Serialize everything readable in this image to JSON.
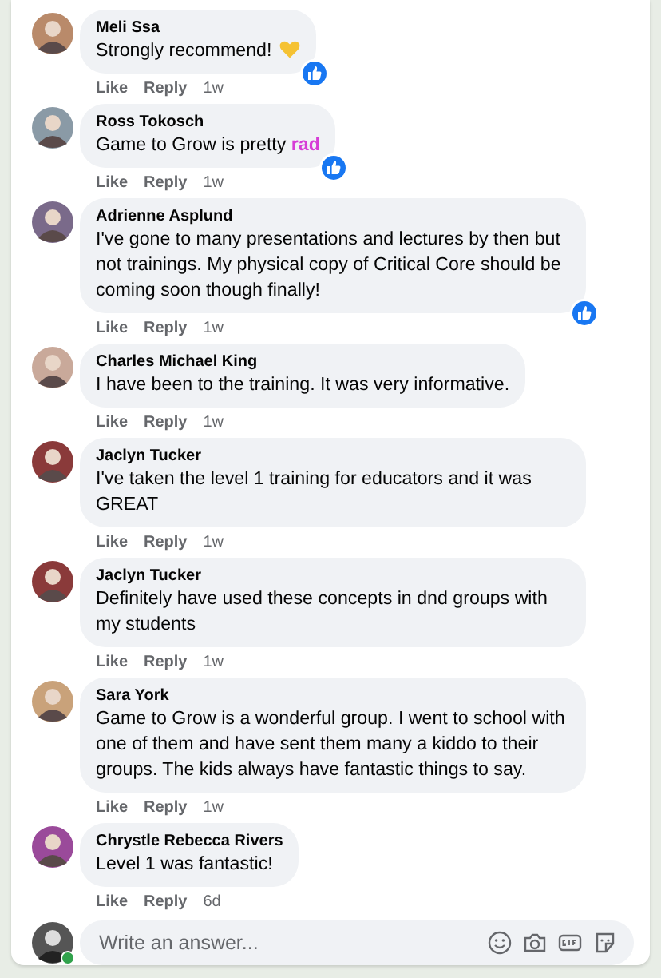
{
  "comments": [
    {
      "author": "Meli Ssa",
      "text": "Strongly recommend!",
      "heart": true,
      "liked": true,
      "actions": [
        "Like",
        "Reply"
      ],
      "time": "1w"
    },
    {
      "author": "Ross Tokosch",
      "text": "Game to Grow is pretty **rad**",
      "liked": true,
      "actions": [
        "Like",
        "Reply"
      ],
      "time": "1w"
    },
    {
      "author": "Adrienne Asplund",
      "text": "I've gone to many presentations and lectures by then but not trainings. My physical copy of Critical Core should be coming soon though finally!",
      "liked": true,
      "actions": [
        "Like",
        "Reply"
      ],
      "time": "1w"
    },
    {
      "author": "Charles Michael King",
      "text": "I have been to the training. It was very informative.",
      "liked": false,
      "actions": [
        "Like",
        "Reply"
      ],
      "time": "1w"
    },
    {
      "author": "Jaclyn Tucker",
      "text": "I've taken the level 1 training for educators and it was GREAT",
      "liked": false,
      "actions": [
        "Like",
        "Reply"
      ],
      "time": "1w"
    },
    {
      "author": "Jaclyn Tucker",
      "text": "Definitely have used these concepts in dnd groups with my students",
      "liked": false,
      "actions": [
        "Like",
        "Reply"
      ],
      "time": "1w"
    },
    {
      "author": "Sara York",
      "text": "Game to Grow is a wonderful group. I went to school with one of them and have sent them many a kiddo to their groups. The kids always have fantastic things to say.",
      "liked": false,
      "actions": [
        "Like",
        "Reply"
      ],
      "time": "1w"
    },
    {
      "author": "Chrystle Rebecca Rivers",
      "text": "Level 1 was fantastic!",
      "liked": false,
      "actions": [
        "Like",
        "Reply"
      ],
      "time": "6d"
    }
  ],
  "composer": {
    "placeholder": "Write an answer...",
    "online": true
  }
}
